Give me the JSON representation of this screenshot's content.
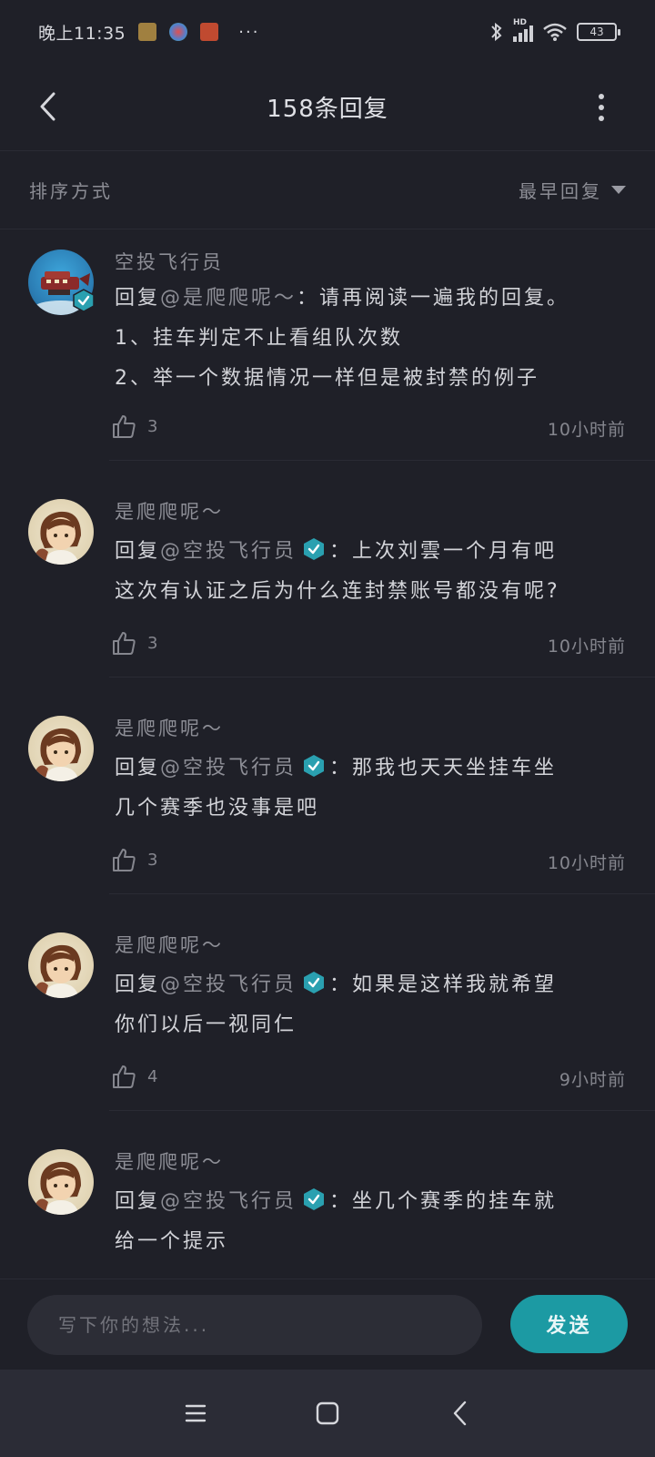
{
  "status_bar": {
    "time": "晚上11:35",
    "dots": "···",
    "network": "HD",
    "battery": "43"
  },
  "header": {
    "title": "158条回复"
  },
  "sort": {
    "label": "排序方式",
    "selected": "最早回复"
  },
  "replies": [
    {
      "author": "空投飞行员",
      "avatar": "airship-avatar",
      "author_verified": true,
      "reply_prefix": "回复",
      "mention": "@是爬爬呢～",
      "mention_verified": false,
      "lines": [
        "：请再阅读一遍我的回复。",
        "1、挂车判定不止看组队次数",
        "2、举一个数据情况一样但是被封禁的例子"
      ],
      "likes": "3",
      "time": "10小时前"
    },
    {
      "author": "是爬爬呢～",
      "avatar": "girl-avatar",
      "author_verified": false,
      "reply_prefix": "回复",
      "mention": "@空投飞行员",
      "mention_verified": true,
      "lines": [
        "：上次刘雲一个月有吧",
        "这次有认证之后为什么连封禁账号都没有呢?"
      ],
      "likes": "3",
      "time": "10小时前"
    },
    {
      "author": "是爬爬呢～",
      "avatar": "girl-avatar",
      "author_verified": false,
      "reply_prefix": "回复",
      "mention": "@空投飞行员",
      "mention_verified": true,
      "lines": [
        "：那我也天天坐挂车坐",
        "几个赛季也没事是吧"
      ],
      "likes": "3",
      "time": "10小时前"
    },
    {
      "author": "是爬爬呢～",
      "avatar": "girl-avatar",
      "author_verified": false,
      "reply_prefix": "回复",
      "mention": "@空投飞行员",
      "mention_verified": true,
      "lines": [
        "：如果是这样我就希望",
        "你们以后一视同仁"
      ],
      "likes": "4",
      "time": "9小时前"
    },
    {
      "author": "是爬爬呢～",
      "avatar": "girl-avatar",
      "author_verified": false,
      "reply_prefix": "回复",
      "mention": "@空投飞行员",
      "mention_verified": true,
      "lines": [
        "：坐几个赛季的挂车就",
        "给一个提示"
      ],
      "likes": "",
      "time": ""
    }
  ],
  "composer": {
    "placeholder": "写下你的想法...",
    "send_label": "发送"
  },
  "colors": {
    "background": "#1f2028",
    "accent": "#1c9aa3",
    "verified": "#2aa0b0"
  }
}
